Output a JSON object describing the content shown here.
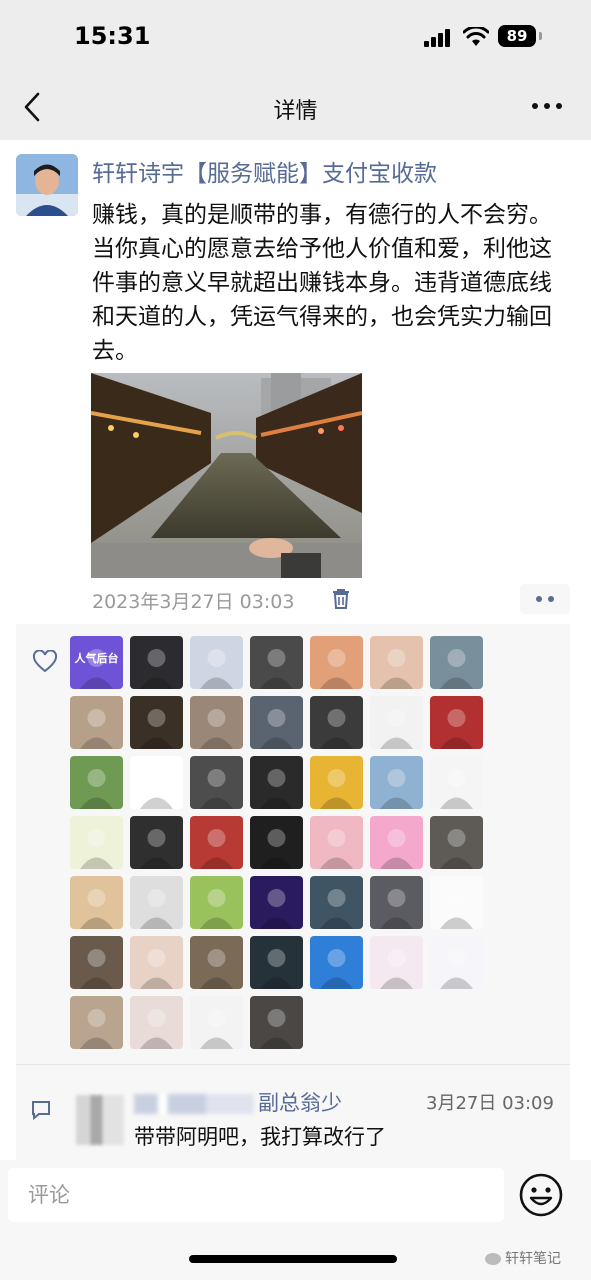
{
  "status_bar": {
    "time": "15:31",
    "battery": "89"
  },
  "nav": {
    "title": "详情"
  },
  "post": {
    "author": "轩轩诗宇【服务赋能】支付宝收款",
    "text": "赚钱，真的是顺带的事，有德行的人不会穷。当你真心的愿意去给予他人价值和爱，利他这件事的意义早就超出赚钱本身。违背道德底线和天道的人，凭运气得来的，也会凭实力输回去。",
    "timestamp": "2023年3月27日 03:03"
  },
  "likers": [
    {
      "bg": "#6e53d6",
      "label": "人气后台"
    },
    {
      "bg": "#2c2c30"
    },
    {
      "bg": "#cfd6e3"
    },
    {
      "bg": "#4a4a4a"
    },
    {
      "bg": "#e2a079"
    },
    {
      "bg": "#e4c2ad"
    },
    {
      "bg": "#7a8f9c"
    },
    {
      "bg": "#b7a08a"
    },
    {
      "bg": "#3a3026"
    },
    {
      "bg": "#9b8778"
    },
    {
      "bg": "#5a6470"
    },
    {
      "bg": "#3b3b3b"
    },
    {
      "bg": "#f2f2f2"
    },
    {
      "bg": "#b23030"
    },
    {
      "bg": "#6f9a53"
    },
    {
      "bg": "#ffffff"
    },
    {
      "bg": "#4d4d4d"
    },
    {
      "bg": "#2a2a2a"
    },
    {
      "bg": "#e8b433"
    },
    {
      "bg": "#8fb2d2"
    },
    {
      "bg": "#f5f5f5"
    },
    {
      "bg": "#eef2d8"
    },
    {
      "bg": "#2f2f2f"
    },
    {
      "bg": "#b83a34"
    },
    {
      "bg": "#1f1f1f"
    },
    {
      "bg": "#f0b8c3"
    },
    {
      "bg": "#f4a8cc"
    },
    {
      "bg": "#5e5a55"
    },
    {
      "bg": "#e0c39a"
    },
    {
      "bg": "#dedede"
    },
    {
      "bg": "#9ac25c"
    },
    {
      "bg": "#2a1a5e"
    },
    {
      "bg": "#3f5564"
    },
    {
      "bg": "#5b5b62"
    },
    {
      "bg": "#fbfbfb"
    },
    {
      "bg": "#6a5a4c"
    },
    {
      "bg": "#e8d2c5"
    },
    {
      "bg": "#7b6a56"
    },
    {
      "bg": "#26323a"
    },
    {
      "bg": "#2f7ed8"
    },
    {
      "bg": "#f5e9f1"
    },
    {
      "bg": "#f6f6fa"
    },
    {
      "bg": "#b8a48f"
    },
    {
      "bg": "#e8dbd8"
    },
    {
      "bg": "#f3f3f3"
    },
    {
      "bg": "#4a4744"
    }
  ],
  "comment": {
    "name": "副总翁少",
    "time": "3月27日 03:09",
    "text": "带带阿明吧，我打算改行了"
  },
  "input": {
    "placeholder": "评论"
  },
  "watermark": "轩轩笔记",
  "colors": {
    "link": "#576b95",
    "nav_bg": "#ededed",
    "panel_bg": "#f7f7f7"
  }
}
